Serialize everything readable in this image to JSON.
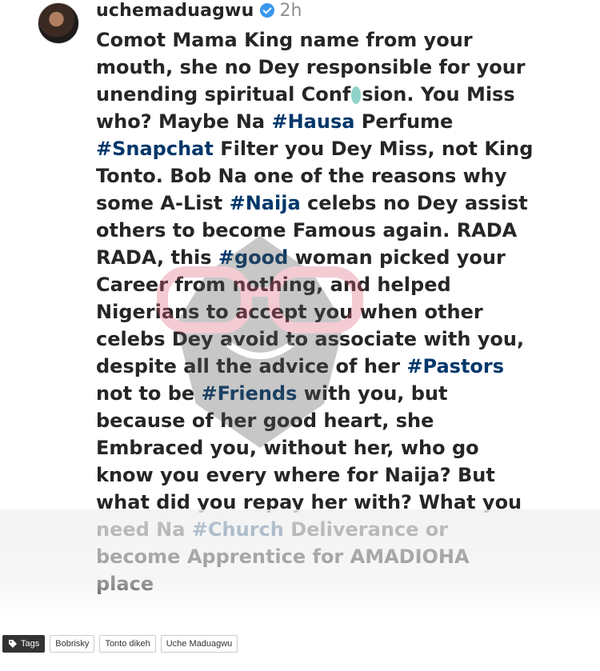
{
  "post": {
    "username": "uchemaduagwu",
    "time": "2h",
    "icons": {
      "verified": "verified-badge-icon"
    },
    "colors": {
      "hashtag": "#00376b",
      "text": "#262626",
      "time": "#8e8e8e",
      "verified": "#3897f0"
    },
    "caption_lines": [
      [
        {
          "text": "Comot Mama King name from your"
        }
      ],
      [
        {
          "text": "mouth, she no Dey responsible for your"
        }
      ],
      [
        {
          "text": "unending spiritual Conf"
        },
        {
          "text": "sion. You Miss"
        }
      ],
      [
        {
          "text": "who? Maybe Na "
        },
        {
          "text": "#Hausa"
        },
        {
          "text": " Perfume"
        }
      ],
      [
        {
          "text": "#Snapchat"
        },
        {
          "text": " Filter you Dey Miss, not King"
        }
      ],
      [
        {
          "text": "Tonto. Bob Na one of the reasons why"
        }
      ],
      [
        {
          "text": "some A-List "
        },
        {
          "text": "#Naija"
        },
        {
          "text": " celebs no Dey assist"
        }
      ],
      [
        {
          "text": "others to become Famous again. RADA"
        }
      ],
      [
        {
          "text": "RADA, this "
        },
        {
          "text": "#good"
        },
        {
          "text": " woman picked your"
        }
      ],
      [
        {
          "text": "Career from nothing, and helped"
        }
      ],
      [
        {
          "text": "Nigerians to accept you when other"
        }
      ],
      [
        {
          "text": "celebs Dey avoid to associate with you,"
        }
      ],
      [
        {
          "text": "despite all the advice of her "
        },
        {
          "text": "#Pastors"
        }
      ],
      [
        {
          "text": "not to be "
        },
        {
          "text": "#Friends"
        },
        {
          "text": " with you, but"
        }
      ],
      [
        {
          "text": "because of her good heart, she"
        }
      ],
      [
        {
          "text": "Embraced you, without her, who go"
        }
      ],
      [
        {
          "text": "know you every where for Naija? But"
        }
      ],
      [
        {
          "text": "what did you repay her with? What you"
        }
      ],
      [
        {
          "text": "need Na "
        },
        {
          "text": "#Church"
        },
        {
          "text": " Deliverance or"
        }
      ],
      [
        {
          "text": "become Apprentice for AMADIOHA"
        }
      ],
      [
        {
          "text": "place"
        }
      ]
    ]
  },
  "tags": {
    "label": "Tags",
    "icon": "tag-icon",
    "items": [
      "Bobrisky",
      "Tonto dikeh",
      "Uche Maduagwu"
    ]
  }
}
